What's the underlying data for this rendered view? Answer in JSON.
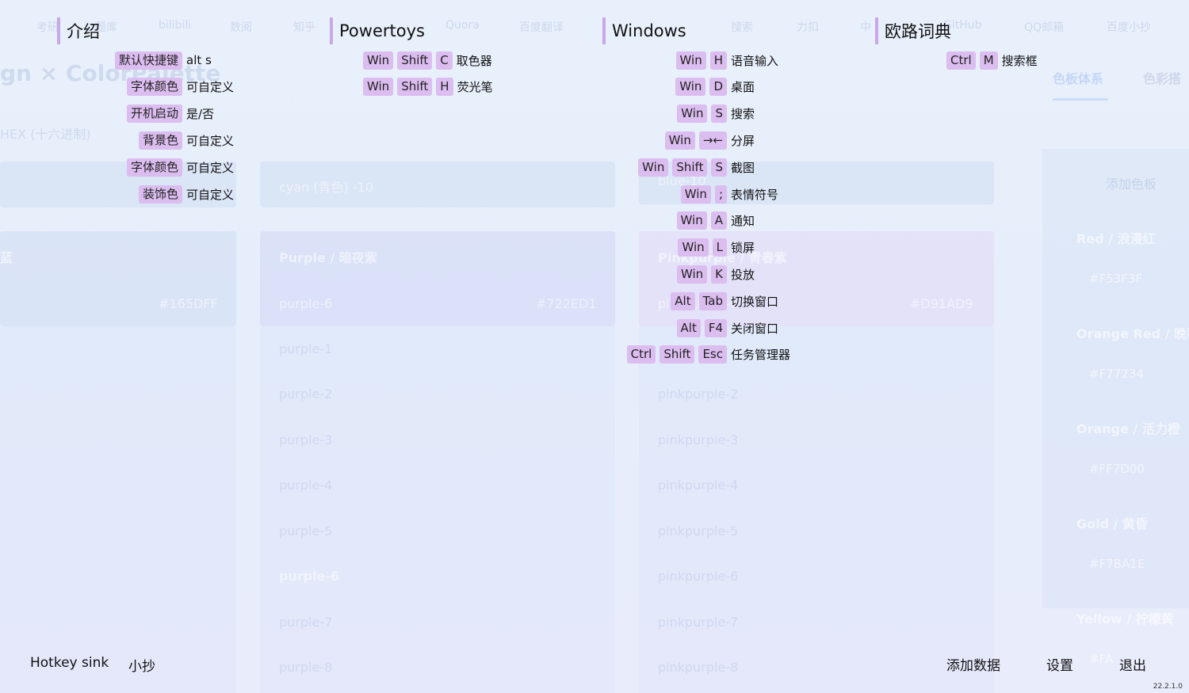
{
  "background": {
    "tabs": [
      "考研",
      "题库",
      "bilibili",
      "数阅",
      "知乎",
      "Quora",
      "百度翻译",
      "搜索",
      "力扣",
      "中",
      "GitHub",
      "QQ邮箱",
      "百度小抄"
    ],
    "title": "gn × ColorPalette",
    "hex_label": "HEX (十六进制)",
    "cyan_label": "cyan (青色) -10",
    "blue_label": "blue-10",
    "blue_card_title": "蓝",
    "blue_card_hex": "#165DFF",
    "purple_card_title": "Purple / 暗夜紫",
    "purple_card_code": "purple-6",
    "purple_card_hex": "#722ED1",
    "pink_card_title": "Pinkpurple / 青春紫",
    "pink_card_code": "pinkpurple-6",
    "pink_card_hex": "#D91AD9",
    "purple_list": [
      "purple-1",
      "purple-2",
      "purple-3",
      "purple-4",
      "purple-5",
      "purple-6",
      "purple-7",
      "purple-8"
    ],
    "pink_list": [
      "pinkpurple-2",
      "pinkpurple-3",
      "pinkpurple-4",
      "pinkpurple-5",
      "pinkpurple-6",
      "pinkpurple-7",
      "pinkpurple-8"
    ],
    "right_tabs": [
      "色板体系",
      "色彩搭"
    ],
    "right_add": "添加色板",
    "right_items": [
      {
        "name": "Red / 浪漫红",
        "hex": "#F53F3F"
      },
      {
        "name": "Orange Red / 晚秋",
        "hex": "#F77234"
      },
      {
        "name": "Orange / 活力橙",
        "hex": "#FF7D00"
      },
      {
        "name": "Gold / 黄昏",
        "hex": "#F7BA1E"
      },
      {
        "name": "Yellow / 柠檬黄",
        "hex": "#FA"
      }
    ]
  },
  "sections": {
    "intro": {
      "title": "介绍",
      "rows": [
        {
          "keys": [
            "默认快捷键"
          ],
          "desc": "alt s"
        },
        {
          "keys": [
            "字体颜色"
          ],
          "desc": "可自定义"
        },
        {
          "keys": [
            "开机启动"
          ],
          "desc": "是/否"
        },
        {
          "keys": [
            "背景色"
          ],
          "desc": "可自定义"
        },
        {
          "keys": [
            "字体颜色"
          ],
          "desc": "可自定义"
        },
        {
          "keys": [
            "装饰色"
          ],
          "desc": "可自定义"
        }
      ]
    },
    "powertoys": {
      "title": "Powertoys",
      "rows": [
        {
          "keys": [
            "Win",
            "Shift",
            "C"
          ],
          "desc": "取色器"
        },
        {
          "keys": [
            "Win",
            "Shift",
            "H"
          ],
          "desc": "荧光笔"
        }
      ]
    },
    "windows": {
      "title": "Windows",
      "rows": [
        {
          "keys": [
            "Win",
            "H"
          ],
          "desc": "语音输入"
        },
        {
          "keys": [
            "Win",
            "D"
          ],
          "desc": "桌面"
        },
        {
          "keys": [
            "Win",
            "S"
          ],
          "desc": "搜索"
        },
        {
          "keys": [
            "Win",
            "→←"
          ],
          "desc": "分屏"
        },
        {
          "keys": [
            "Win",
            "Shift",
            "S"
          ],
          "desc": "截图"
        },
        {
          "keys": [
            "Win",
            ";"
          ],
          "desc": "表情符号"
        },
        {
          "keys": [
            "Win",
            "A"
          ],
          "desc": "通知"
        },
        {
          "keys": [
            "Win",
            "L"
          ],
          "desc": "锁屏"
        },
        {
          "keys": [
            "Win",
            "K"
          ],
          "desc": "投放"
        },
        {
          "keys": [
            "Alt",
            "Tab"
          ],
          "desc": "切换窗口"
        },
        {
          "keys": [
            "Alt",
            "F4"
          ],
          "desc": "关闭窗口"
        },
        {
          "keys": [
            "Ctrl",
            "Shift",
            "Esc"
          ],
          "desc": "任务管理器"
        }
      ]
    },
    "dict": {
      "title": "欧路词典",
      "rows": [
        {
          "keys": [
            "Ctrl",
            "M"
          ],
          "desc": "搜索框"
        }
      ]
    }
  },
  "bottom": {
    "app_name": "Hotkey sink",
    "tag": "小抄",
    "add_data": "添加数据",
    "settings": "设置",
    "exit": "退出",
    "version": "22.2.1.0"
  },
  "colors": {
    "key_bg": "#dcbdf0",
    "bar": "#c9a8ea"
  }
}
